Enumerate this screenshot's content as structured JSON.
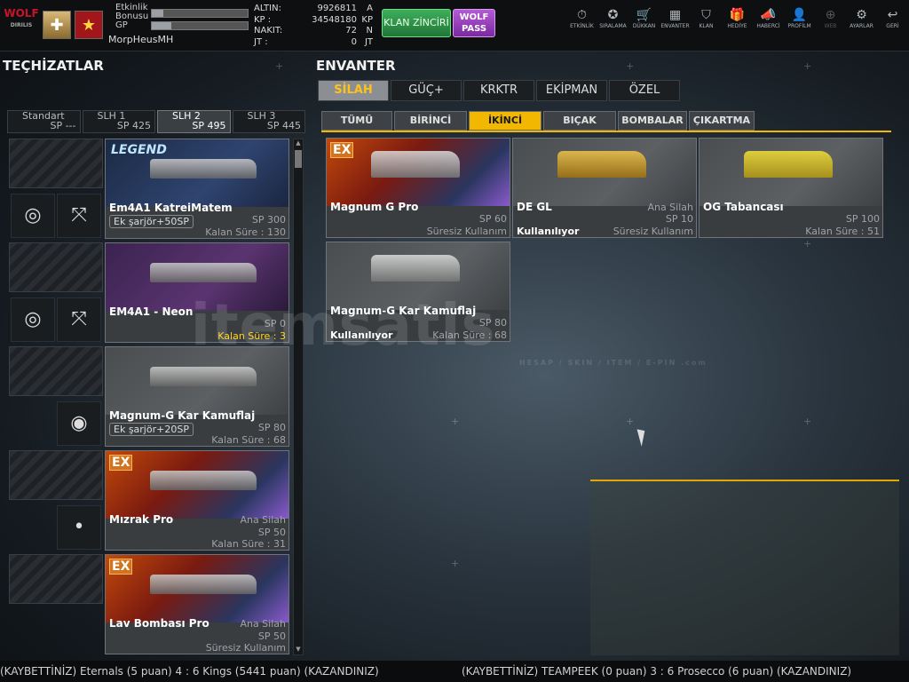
{
  "topbar": {
    "logo_text": "WOLF",
    "logo_sub": "DIRILIS",
    "etkinlik_label": "Etkinlik Bonusu",
    "etkinlik_fill": 0.12,
    "gp_label": "GP",
    "gp_fill": 0.2,
    "username": "MorpHeusMH",
    "currency": [
      {
        "key": "ALTIN:",
        "value": "9926811",
        "unit": "A"
      },
      {
        "key": "KP :",
        "value": "34548180",
        "unit": "KP"
      },
      {
        "key": "NAKIT:",
        "value": "72",
        "unit": "N"
      },
      {
        "key": "JT :",
        "value": "0",
        "unit": "JT"
      }
    ],
    "klan_zinciri": "KLAN ZİNCİRİ",
    "wolf_pass": "WOLF PASS",
    "nav": [
      {
        "label": "ETKİNLİK",
        "icon": "stopwatch-icon",
        "glyph": "⏱",
        "dim": false
      },
      {
        "label": "SIRALAMA",
        "icon": "medal-icon",
        "glyph": "✪",
        "dim": false
      },
      {
        "label": "DÜKKAN",
        "icon": "cart-icon",
        "glyph": "🛒",
        "dim": false
      },
      {
        "label": "ENVANTER",
        "icon": "inventory-icon",
        "glyph": "▦",
        "dim": false
      },
      {
        "label": "KLAN",
        "icon": "shield-icon",
        "glyph": "⛉",
        "dim": false
      },
      {
        "label": "HEDİYE",
        "icon": "gift-icon",
        "glyph": "🎁",
        "dim": false
      },
      {
        "label": "HABERCİ",
        "icon": "megaphone-icon",
        "glyph": "📣",
        "dim": false
      },
      {
        "label": "PROFİLM",
        "icon": "profile-icon",
        "glyph": "👤",
        "dim": false
      },
      {
        "label": "WEB",
        "icon": "globe-icon",
        "glyph": "⊕",
        "dim": true
      },
      {
        "label": "AYARLAR",
        "icon": "gear-icon",
        "glyph": "⚙",
        "dim": false
      },
      {
        "label": "GERİ",
        "icon": "back-icon",
        "glyph": "↩",
        "dim": false
      }
    ]
  },
  "left": {
    "title": "TEÇHİZATLAR",
    "slots": [
      {
        "name": "Standart",
        "sp": "SP ---",
        "active": false
      },
      {
        "name": "SLH 1",
        "sp": "SP 425",
        "active": false
      },
      {
        "name": "SLH 2",
        "sp": "SP 495",
        "active": true
      },
      {
        "name": "SLH 3",
        "sp": "SP 445",
        "active": false
      }
    ],
    "equipped": [
      {
        "name": "Em4A1 KatreiMatem",
        "tag": "Ek şarjör+50SP",
        "sp": "SP 300",
        "kalan": "Kalan Süre : 130",
        "ana": "",
        "suresiz": "",
        "ex": false,
        "legend": true,
        "kalan_yellow": false,
        "bg": "linear-gradient(135deg,#1b2a45,#2f4470 60%,#1b2640)"
      },
      {
        "name": "EM4A1 - Neon",
        "tag": "",
        "sp": "SP 0",
        "kalan": "Kalan Süre : 3",
        "ana": "",
        "suresiz": "",
        "ex": false,
        "legend": false,
        "kalan_yellow": true,
        "bg": "linear-gradient(135deg,#3b2350,#5a3470 60%,#2a1a3a)"
      },
      {
        "name": "Magnum-G Kar Kamuflaj",
        "tag": "Ek şarjör+20SP",
        "sp": "SP 80",
        "kalan": "Kalan Süre : 68",
        "ana": "",
        "suresiz": "",
        "ex": false,
        "legend": false,
        "kalan_yellow": false,
        "bg": "linear-gradient(135deg,#4a4d50,#5c6063 60%,#3e4144)"
      },
      {
        "name": "Mızrak Pro",
        "tag": "",
        "sp": "SP 50",
        "kalan": "Kalan Süre : 31",
        "ana": "Ana Silah",
        "suresiz": "",
        "ex": true,
        "legend": false,
        "kalan_yellow": false,
        "bg": "linear-gradient(135deg,#c24a0a,#7a1a10 40%,#2a3660 75%,#8a5acd)"
      },
      {
        "name": "Lav Bombası Pro",
        "tag": "",
        "sp": "SP 50",
        "kalan": "",
        "ana": "Ana Silah",
        "suresiz": "Süresiz Kullanım",
        "ex": true,
        "legend": false,
        "kalan_yellow": false,
        "bg": "linear-gradient(135deg,#c24a0a,#7a1a10 40%,#2a3660 75%,#8a5acd)"
      }
    ]
  },
  "right": {
    "title": "ENVANTER",
    "tabs": [
      {
        "label": "SİLAH",
        "active": true
      },
      {
        "label": "GÜÇ+",
        "active": false
      },
      {
        "label": "KRKTR",
        "active": false
      },
      {
        "label": "EKİPMAN",
        "active": false
      },
      {
        "label": "ÖZEL",
        "active": false
      }
    ],
    "subtabs": [
      {
        "label": "TÜMÜ",
        "active": false
      },
      {
        "label": "BİRİNCİ",
        "active": false
      },
      {
        "label": "İKİNCİ",
        "active": true
      },
      {
        "label": "BIÇAK",
        "active": false
      },
      {
        "label": "BOMBALAR",
        "active": false
      },
      {
        "label": "ÇIKARTMA",
        "active": false
      }
    ],
    "items": [
      {
        "name": "Magnum G Pro",
        "sp": "SP 60",
        "ana": "",
        "bottom": "Süresiz Kullanım",
        "using": "",
        "ex": true,
        "bg": "linear-gradient(135deg,#c24a0a,#7a1a10 40%,#2a3660 75%,#8a5acd)"
      },
      {
        "name": "DE GL",
        "sp": "SP 10",
        "ana": "Ana Silah",
        "bottom": "Süresiz Kullanım",
        "using": "Kullanılıyor",
        "ex": false,
        "bg": "linear-gradient(135deg,#4a4d50,#5c6063 60%,#3e4144)"
      },
      {
        "name": "OG Tabancası",
        "sp": "SP 100",
        "ana": "",
        "bottom": "Kalan Süre : 51",
        "using": "",
        "ex": false,
        "bg": "linear-gradient(135deg,#4a4d50,#5c6063 60%,#3e4144)"
      },
      {
        "name": "Magnum-G Kar Kamuflaj",
        "sp": "SP 80",
        "ana": "",
        "bottom": "Kalan Süre : 68",
        "using": "Kullanılıyor",
        "ex": false,
        "bg": "linear-gradient(135deg,#4a4d50,#5c6063 60%,#3e4144)"
      }
    ]
  },
  "ticker": {
    "left": "(KAYBETTİNİZ) Eternals (5 puan) 4 : 6 Kings (5441 puan) (KAZANDINIZ)",
    "right": "(KAYBETTİNİZ) TEAMPEEK (0 puan) 3 : 6 Prosecco (6 puan) (KAZANDINIZ)"
  },
  "watermark": {
    "main": "itemsatis",
    "sub": "HESAP / SKIN / ITEM / E-PIN .com"
  }
}
